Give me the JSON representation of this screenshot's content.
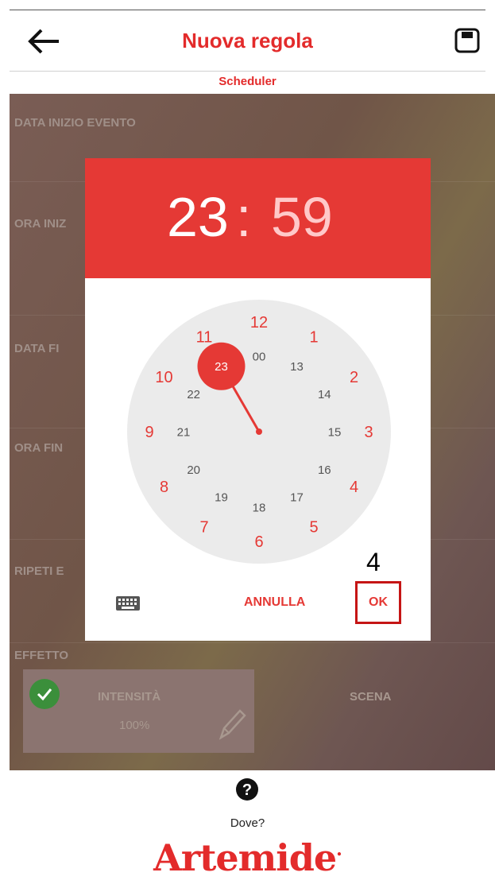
{
  "app": {
    "title": "Nuova regola",
    "subtitle": "Scheduler"
  },
  "icons": {
    "back": "arrow-left-icon",
    "save": "floppy-disk-icon",
    "keyboard": "keyboard-icon",
    "help": "question-circle-icon",
    "check": "check-circle-icon",
    "edit": "pencil-icon"
  },
  "background_sections": [
    "DATA INIZIO EVENTO",
    "ORA INIZ",
    "DATA FI",
    "ORA FIN",
    "RIPETI E",
    "EFFETTO"
  ],
  "tiles": {
    "intensity_label": "INTENSITÀ",
    "intensity_value": "100%",
    "scene_label": "SCENA"
  },
  "time_picker": {
    "hour": "23",
    "separator": ":",
    "minute": "59",
    "selected": "23",
    "outer_ring": [
      "12",
      "1",
      "2",
      "3",
      "4",
      "5",
      "6",
      "7",
      "8",
      "9",
      "10",
      "11"
    ],
    "inner_ring": [
      "00",
      "13",
      "14",
      "15",
      "16",
      "17",
      "18",
      "19",
      "20",
      "21",
      "22",
      "23"
    ],
    "cancel_label": "ANNULLA",
    "ok_label": "OK",
    "step_marker": "4"
  },
  "footer": {
    "help_label": "Dove?",
    "brand": "Artemide"
  },
  "colors": {
    "accent": "#e53935",
    "header_title": "#e32b2b",
    "dial": "#ebebeb",
    "highlight_box": "#c51515",
    "success": "#3b8f3b"
  }
}
